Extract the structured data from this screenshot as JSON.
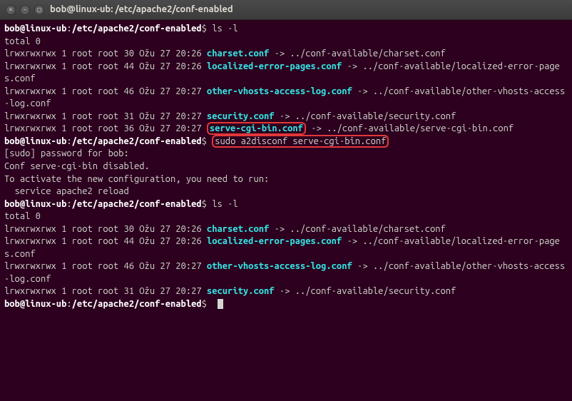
{
  "window": {
    "title": "bob@linux-ub: /etc/apache2/conf-enabled"
  },
  "prompt": {
    "user_host": "bob@linux-ub",
    "path": "/etc/apache2/conf-enabled",
    "sep": ":",
    "end": "$"
  },
  "cmd": {
    "ls": "ls -l",
    "total": "total 0",
    "sudo": "sudo a2disconf serve-cgi-bin.conf",
    "sudo_pw": "[sudo] password for bob:",
    "disabled": "Conf serve-cgi-bin disabled.",
    "activate": "To activate the new configuration, you need to run:",
    "service": "  service apache2 reload"
  },
  "entries1": [
    {
      "perm": "lrwxrwxrwx 1 root root 30 Ožu 27 20:26 ",
      "name": "charset.conf",
      "target": " -> ../conf-available/charset.conf"
    },
    {
      "perm": "lrwxrwxrwx 1 root root 44 Ožu 27 20:26 ",
      "name": "localized-error-pages.conf",
      "target": " -> ../conf-available/localized-error-pages.conf"
    },
    {
      "perm": "lrwxrwxrwx 1 root root 46 Ožu 27 20:27 ",
      "name": "other-vhosts-access-log.conf",
      "target": " -> ../conf-available/other-vhosts-access-log.conf"
    },
    {
      "perm": "lrwxrwxrwx 1 root root 31 Ožu 27 20:27 ",
      "name": "security.conf",
      "target": " -> ../conf-available/security.conf"
    },
    {
      "perm": "lrwxrwxrwx 1 root root 36 Ožu 27 20:27 ",
      "name": "serve-cgi-bin.conf",
      "target": " -> ../conf-available/serve-cgi-bin.conf",
      "boxed": true
    }
  ],
  "entries2": [
    {
      "perm": "lrwxrwxrwx 1 root root 30 Ožu 27 20:26 ",
      "name": "charset.conf",
      "target": " -> ../conf-available/charset.conf"
    },
    {
      "perm": "lrwxrwxrwx 1 root root 44 Ožu 27 20:26 ",
      "name": "localized-error-pages.conf",
      "target": " -> ../conf-available/localized-error-pages.conf"
    },
    {
      "perm": "lrwxrwxrwx 1 root root 46 Ožu 27 20:27 ",
      "name": "other-vhosts-access-log.conf",
      "target": " -> ../conf-available/other-vhosts-access-log.conf"
    },
    {
      "perm": "lrwxrwxrwx 1 root root 31 Ožu 27 20:27 ",
      "name": "security.conf",
      "target": " -> ../conf-available/security.conf"
    }
  ]
}
